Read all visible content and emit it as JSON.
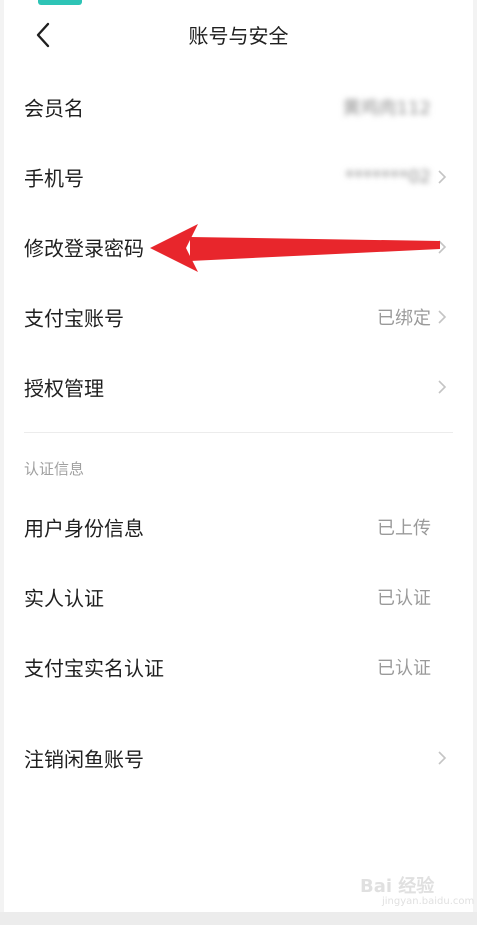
{
  "header": {
    "title": "账号与安全",
    "back_icon": "chevron-left-icon"
  },
  "account": {
    "member_name_label": "会员名",
    "member_name_value": "黄鸡肉112",
    "phone_label": "手机号",
    "phone_value": "*******02",
    "change_password_label": "修改登录密码",
    "alipay_label": "支付宝账号",
    "alipay_value": "已绑定",
    "authorization_label": "授权管理"
  },
  "verification": {
    "section_title": "认证信息",
    "identity_label": "用户身份信息",
    "identity_value": "已上传",
    "realname_label": "实人认证",
    "realname_value": "已认证",
    "alipay_realname_label": "支付宝实名认证",
    "alipay_realname_value": "已认证"
  },
  "cancel_account_label": "注销闲鱼账号",
  "watermark": {
    "text": "Bai 经验",
    "sub": "jingyan.baidu.com"
  },
  "colors": {
    "annotation_arrow": "#e8262c",
    "secondary_text": "#9a9a9a",
    "chevron": "#c4c4c4"
  }
}
